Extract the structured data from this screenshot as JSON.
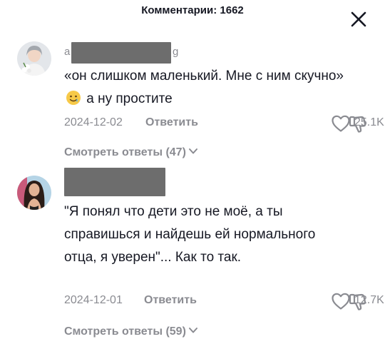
{
  "header": {
    "title": "Комментарии: 1662"
  },
  "icons": {
    "close": "close-icon",
    "like": "heart-outline-icon",
    "dislike": "thumbs-down-icon",
    "expand": "chevron-down-icon",
    "emoji": "pleading-smile-emoji"
  },
  "comments": [
    {
      "username_visible_start": "a",
      "username_visible_end": "g",
      "text_before_emoji": "«он слишком маленький. Мне с ним скучно»",
      "text_after_emoji": "а ну простите",
      "date": "2024-12-02",
      "reply_label": "Ответить",
      "likes": "25.1K",
      "view_replies": "Смотреть ответы (47)"
    },
    {
      "text": "\"Я понял что дети это не моё, а ты справишься и найдешь ей нормального отца, я уверен\"... Как то так.",
      "date": "2024-12-01",
      "reply_label": "Ответить",
      "likes": "12.7K",
      "view_replies": "Смотреть ответы (59)"
    }
  ],
  "colors": {
    "text_primary": "#161823",
    "text_secondary": "#8a8b91",
    "redaction": "#6d6d6d",
    "background": "#ffffff"
  }
}
